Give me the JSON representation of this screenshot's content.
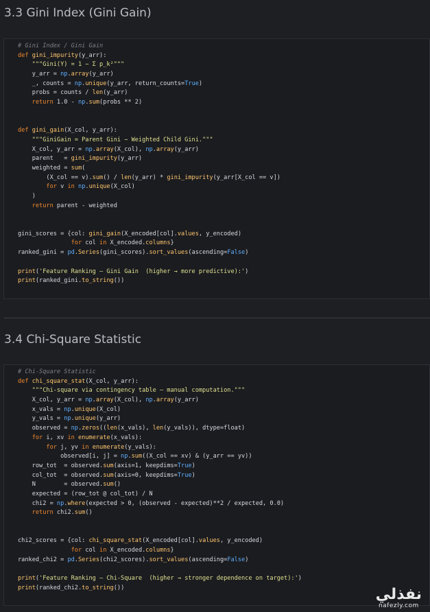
{
  "section1": {
    "title": "3.3 Gini Index (Gini Gain)",
    "lines": [
      "# Gini Index / Gini Gain",
      "def gini_impurity(y_arr):",
      "    \"\"\"Gini(Y) = 1 − Σ p_k²\"\"\"",
      "    y_arr = np.array(y_arr)",
      "    _, counts = np.unique(y_arr, return_counts=True)",
      "    probs = counts / len(y_arr)",
      "    return 1.0 - np.sum(probs ** 2)",
      "",
      "",
      "def gini_gain(X_col, y_arr):",
      "    \"\"\"GiniGain = Parent Gini − Weighted Child Gini.\"\"\"",
      "    X_col, y_arr = np.array(X_col), np.array(y_arr)",
      "    parent   = gini_impurity(y_arr)",
      "    weighted = sum(",
      "        (X_col == v).sum() / len(y_arr) * gini_impurity(y_arr[X_col == v])",
      "        for v in np.unique(X_col)",
      "    )",
      "    return parent - weighted",
      "",
      "",
      "gini_scores = {col: gini_gain(X_encoded[col].values, y_encoded)",
      "               for col in X_encoded.columns}",
      "ranked_gini = pd.Series(gini_scores).sort_values(ascending=False)",
      "",
      "print('Feature Ranking — Gini Gain  (higher → more predictive):')",
      "print(ranked_gini.to_string())"
    ]
  },
  "section2": {
    "title": "3.4 Chi-Square Statistic",
    "lines": [
      "# Chi-Square Statistic",
      "def chi_square_stat(X_col, y_arr):",
      "    \"\"\"Chi-square via contingency table — manual computation.\"\"\"",
      "    X_col, y_arr = np.array(X_col), np.array(y_arr)",
      "    x_vals = np.unique(X_col)",
      "    y_vals = np.unique(y_arr)",
      "    observed = np.zeros((len(x_vals), len(y_vals)), dtype=float)",
      "    for i, xv in enumerate(x_vals):",
      "        for j, yv in enumerate(y_vals):",
      "            observed[i, j] = np.sum((X_col == xv) & (y_arr == yv))",
      "    row_tot  = observed.sum(axis=1, keepdims=True)",
      "    col_tot  = observed.sum(axis=0, keepdims=True)",
      "    N        = observed.sum()",
      "    expected = (row_tot @ col_tot) / N",
      "    chi2 = np.where(expected > 0, (observed - expected)**2 / expected, 0.0)",
      "    return chi2.sum()",
      "",
      "",
      "chi2_scores = {col: chi_square_stat(X_encoded[col].values, y_encoded)",
      "               for col in X_encoded.columns}",
      "ranked_chi2 = pd.Series(chi2_scores).sort_values(ascending=False)",
      "",
      "print('Feature Ranking — Chi-Square  (higher → stronger dependence on target):')",
      "print(ranked_chi2.to_string())"
    ]
  },
  "watermark": {
    "logo": "نفذلي",
    "url": "nafezly.com"
  }
}
